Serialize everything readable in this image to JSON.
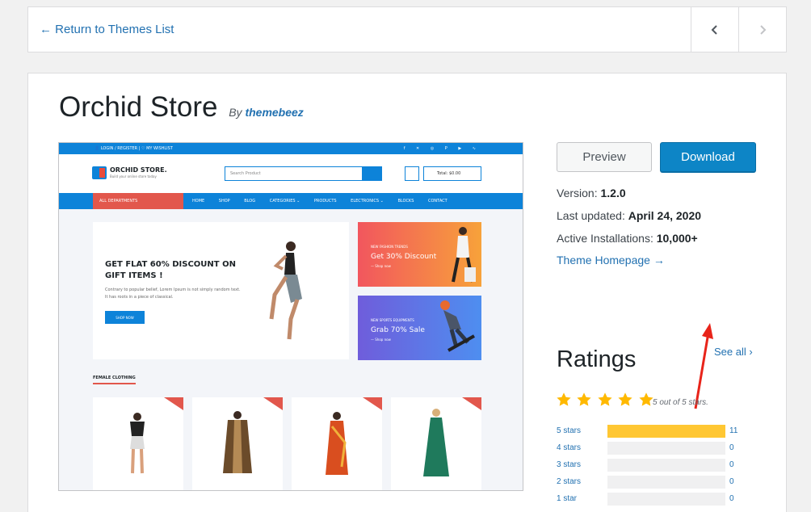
{
  "nav": {
    "back_label": "← Return to Themes List"
  },
  "theme": {
    "name": "Orchid Store",
    "by": "By",
    "author": "themebeez",
    "version_label": "Version:",
    "version": "1.2.0",
    "updated_label": "Last updated:",
    "updated": "April 24, 2020",
    "installs_label": "Active Installations:",
    "installs": "10,000+",
    "homepage_label": "Theme Homepage →"
  },
  "actions": {
    "preview": "Preview",
    "download": "Download"
  },
  "ratings": {
    "heading": "Ratings",
    "see_all": "See all",
    "summary": "5 out of 5 stars.",
    "star_color": "#ffb900",
    "rows": [
      {
        "label": "5 stars",
        "count": "11",
        "fraction": 1.0
      },
      {
        "label": "4 stars",
        "count": "0",
        "fraction": 0
      },
      {
        "label": "3 stars",
        "count": "0",
        "fraction": 0
      },
      {
        "label": "2 stars",
        "count": "0",
        "fraction": 0
      },
      {
        "label": "1 star",
        "count": "0",
        "fraction": 0
      }
    ]
  },
  "preview_shot": {
    "account_links": "👤 LOGIN / REGISTER   |   ♡ MY WISHLIST",
    "social": "f ✕ ◎ P ▶ ∿",
    "logo": "ORCHID STORE.",
    "tagline": "Build your online store today",
    "search_placeholder": "Search Product",
    "cart": "Total: $0.00",
    "departments": "ALL DEPARTMENTS",
    "menu": [
      "HOME",
      "SHOP",
      "BLOG",
      "CATEGORIES ⌄",
      "PRODUCTS",
      "ELECTRONICS ⌄",
      "BLOCKS",
      "CONTACT"
    ],
    "hero_heading": "GET FLAT 60% DISCOUNT ON GIFT ITEMS !",
    "hero_text": "Contrary to popular belief, Lorem Ipsum is not simply random text. It has roots in a piece of classical.",
    "hero_button": "SHOP NOW",
    "banner1_kicker": "NEW FASHION TRENDS",
    "banner1_title": "Get 30% Discount",
    "banner1_link": "— Shop now",
    "banner2_kicker": "NEW SPORTS EQUIPMENTS",
    "banner2_title": "Grab 70% Sale",
    "banner2_link": "— Shop now",
    "section_title": "FEMALE CLOTHING",
    "sale_badge": "SALE!"
  }
}
